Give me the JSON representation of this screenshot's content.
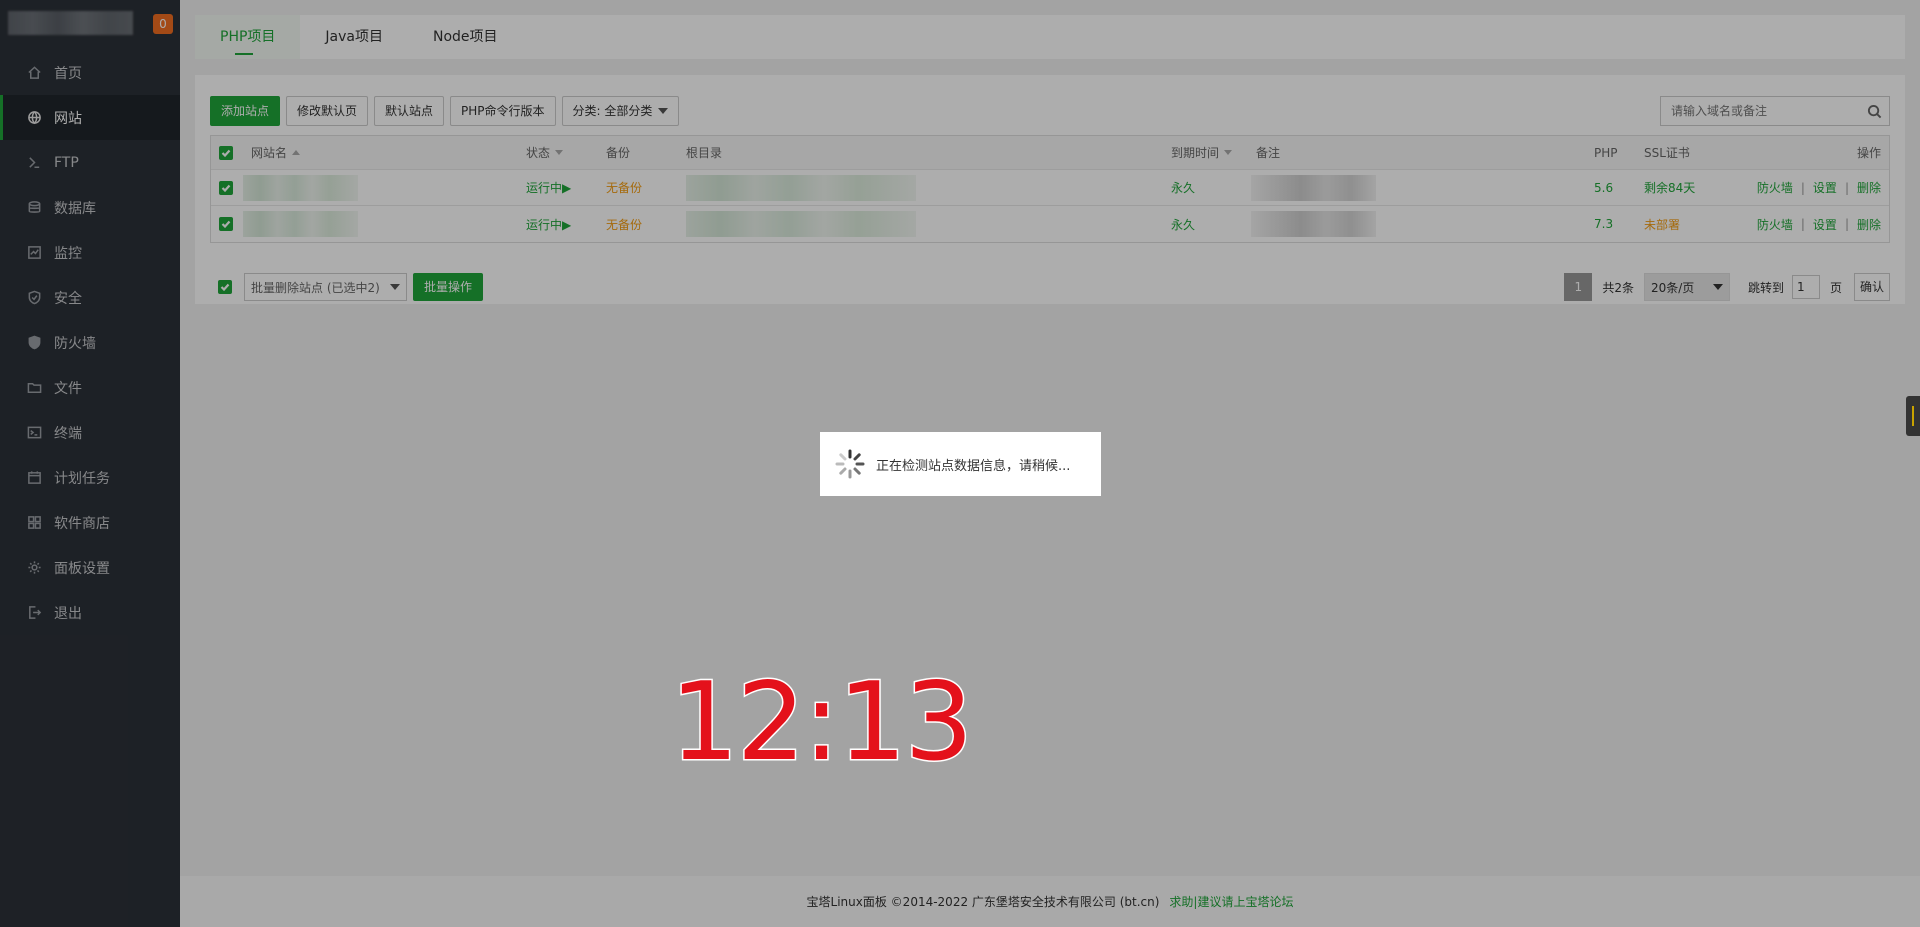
{
  "sidebar": {
    "badge": "0",
    "items": [
      {
        "label": "首页",
        "icon": "home-icon"
      },
      {
        "label": "网站",
        "icon": "globe-icon",
        "active": true
      },
      {
        "label": "FTP",
        "icon": "ftp-icon"
      },
      {
        "label": "数据库",
        "icon": "database-icon"
      },
      {
        "label": "监控",
        "icon": "monitor-icon"
      },
      {
        "label": "安全",
        "icon": "shield-icon"
      },
      {
        "label": "防火墙",
        "icon": "firewall-icon"
      },
      {
        "label": "文件",
        "icon": "folder-icon"
      },
      {
        "label": "终端",
        "icon": "terminal-icon"
      },
      {
        "label": "计划任务",
        "icon": "calendar-icon"
      },
      {
        "label": "软件商店",
        "icon": "apps-icon"
      },
      {
        "label": "面板设置",
        "icon": "gear-icon"
      },
      {
        "label": "退出",
        "icon": "logout-icon"
      }
    ]
  },
  "tabs": [
    {
      "label": "PHP项目",
      "active": true
    },
    {
      "label": "Java项目"
    },
    {
      "label": "Node项目"
    }
  ],
  "toolbar": {
    "add_site": "添加站点",
    "modify_default": "修改默认页",
    "default_site": "默认站点",
    "php_cli": "PHP命令行版本",
    "category": "分类: 全部分类",
    "search_placeholder": "请输入域名或备注"
  },
  "table": {
    "headers": {
      "name": "网站名",
      "status": "状态",
      "backup": "备份",
      "root": "根目录",
      "expire": "到期时间",
      "remark": "备注",
      "php": "PHP",
      "ssl": "SSL证书",
      "ops": "操作"
    },
    "rows": [
      {
        "status": "运行中▶",
        "backup": "无备份",
        "expire": "永久",
        "php": "5.6",
        "ssl": "剩余84天",
        "ssl_ok": true
      },
      {
        "status": "运行中▶",
        "backup": "无备份",
        "expire": "永久",
        "php": "7.3",
        "ssl": "未部署",
        "ssl_ok": false
      }
    ],
    "ops": {
      "firewall": "防火墙",
      "settings": "设置",
      "delete": "删除",
      "sep": "|"
    }
  },
  "bulk": {
    "select_label": "批量删除站点 (已选中2)",
    "button": "批量操作"
  },
  "pager": {
    "current": "1",
    "total": "共2条",
    "page_size": "20条/页",
    "jump_label": "跳转到",
    "jump_value": "1",
    "unit": "页",
    "confirm": "确认"
  },
  "footer": {
    "copyright": "宝塔Linux面板 ©2014-2022 广东堡塔安全技术有限公司 (bt.cn)",
    "link": "求助|建议请上宝塔论坛"
  },
  "loading": {
    "message": "正在检测站点数据信息，请稍候..."
  },
  "clock": "12:13",
  "colors": {
    "accent": "#20a53a",
    "warning": "#f39c12",
    "sidebar_bg": "#2c3138",
    "badge": "#f16d21"
  }
}
